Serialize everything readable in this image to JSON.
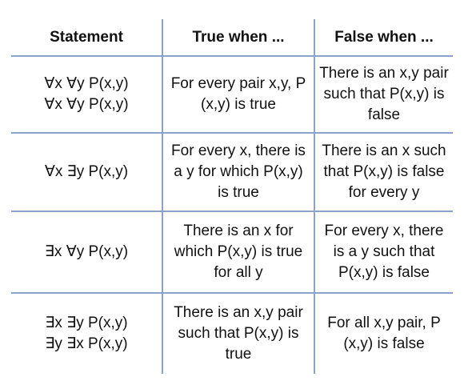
{
  "headers": {
    "statement": "Statement",
    "true_when": "True when ...",
    "false_when": "False when ..."
  },
  "rows": [
    {
      "statement_lines": [
        "∀x ∀y P(x,y)",
        "∀x ∀y P(x,y)"
      ],
      "true_when": "For every pair x,y, P (x,y) is true",
      "false_when": "There is an x,y pair such that P(x,y) is false"
    },
    {
      "statement_lines": [
        "∀x ∃y P(x,y)",
        ""
      ],
      "true_when": "For every x, there is a y for which P(x,y) is true",
      "false_when": "There is an x such that P(x,y) is false for every y"
    },
    {
      "statement_lines": [
        "∃x ∀y P(x,y)",
        ""
      ],
      "true_when": "There is an x for which P(x,y) is true for all y",
      "false_when": "For every x, there is a y such that P(x,y) is false"
    },
    {
      "statement_lines": [
        "∃x ∃y P(x,y)",
        "∃y ∃x P(x,y)"
      ],
      "true_when": "There is an x,y pair such that P(x,y) is true",
      "false_when": "For all x,y pair, P (x,y) is false"
    }
  ],
  "colors": {
    "grid": "#8ca3c7",
    "text": "#111111"
  }
}
